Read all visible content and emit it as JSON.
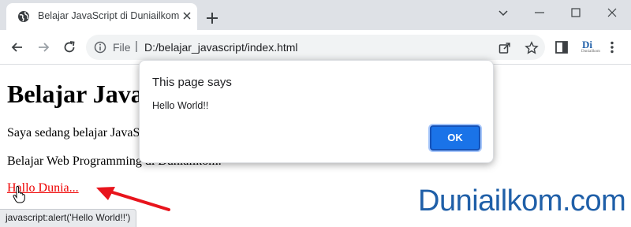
{
  "browser": {
    "tab": {
      "title": "Belajar JavaScript di Duniailkom",
      "favicon": "globe-icon"
    },
    "scheme_label": "File",
    "separator": "|",
    "url": "D:/belajar_javascript/index.html",
    "extension": {
      "label": "Di",
      "sublabel": "Duniailkom"
    }
  },
  "page": {
    "heading": "Belajar JavaScript",
    "paragraph1": "Saya sedang belajar JavaScript",
    "paragraph2": "Belajar Web Programming di Duniailkom.",
    "link_text": "Hallo Dunia...",
    "brand": "Duniailkom.com"
  },
  "status_bar": "javascript:alert('Hello World!!')",
  "dialog": {
    "title": "This page says",
    "message": "Hello World!!",
    "ok_label": "OK"
  },
  "colors": {
    "accent": "#1a73e8",
    "link": "#ee0000",
    "brand": "#1f5fa8",
    "annotation_arrow": "#e8141c"
  }
}
